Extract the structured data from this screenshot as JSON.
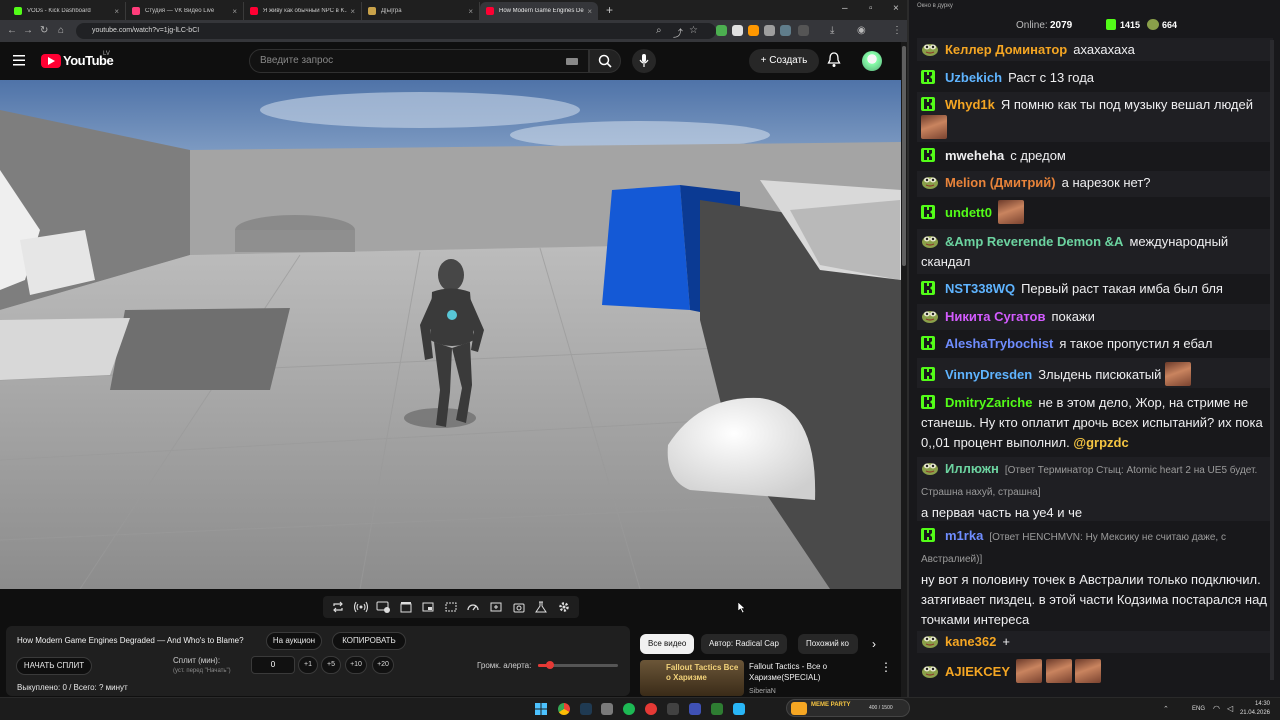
{
  "browser": {
    "tabs": [
      {
        "title": "VODs - Kick Dashboard",
        "color": "#53fc18"
      },
      {
        "title": "Студия — VK Видео Live",
        "color": "#ff3c7a"
      },
      {
        "title": "Я живу как обычный NPC в K...",
        "color": "#ff0033"
      },
      {
        "title": "Д[ы]гра",
        "color": "#c9a24a"
      },
      {
        "title": "How Modern Game Engines De...",
        "color": "#ff0033"
      }
    ],
    "url": "youtube.com/watch?v=1jg-lLC-bCI"
  },
  "youtube": {
    "logo_text": "YouTube",
    "country": "LV",
    "search_placeholder": "Введите запрос",
    "create_label": "Создать"
  },
  "panel": {
    "video_title": "How Modern Game Engines Degraded — And Who's to Blame?",
    "auction_label": "На аукцион",
    "copy_label": "КОПИРОВАТЬ",
    "start_split_label": "НАЧАТЬ СПЛИТ",
    "split_label": "Сплит (мин):",
    "split_sublabel": "(уст. перед \"Начать\")",
    "split_value": "0",
    "increments": [
      "+1",
      "+5",
      "+10",
      "+20"
    ],
    "volume_label": "Громк. алерта:",
    "volume_level": 0.15,
    "status_text": "Выкуплено: 0 / Всего: ? минут"
  },
  "recommendations": {
    "chips": [
      "Все видео",
      "Автор: Radical Cap",
      "Похожий ко"
    ],
    "item": {
      "title": "Fallout Tactics - Все о Харизме(SPECIAL)",
      "channel": "SiberiaN",
      "thumb_text": "Fallout Tactics Все о Харизме"
    }
  },
  "chat": {
    "window_title": "Окно в дуркy",
    "online_label": "Online:",
    "online_count": "2079",
    "kick_count": "1415",
    "other_count": "664",
    "messages": [
      {
        "user": "Келлер Доминатор",
        "color": "#f5a623",
        "badge": "pepe",
        "text": "ахахахаха"
      },
      {
        "user": "Uzbekich",
        "color": "#5fb4ff",
        "badge": "kick",
        "text": "Раст с 13 года"
      },
      {
        "user": "Whyd1k",
        "color": "#f5a623",
        "badge": "kick",
        "text": "Я помню как ты под музыку вешал людей"
      },
      {
        "user": "mweheha",
        "color": "#efeff1",
        "badge": "kick",
        "text": "с дредом"
      },
      {
        "user": "Melion (Дмитрий)",
        "color": "#e8833a",
        "badge": "pepe",
        "text": "а нарезок нет?"
      },
      {
        "user": "undett0",
        "color": "#53fc18",
        "badge": "kick",
        "text": ""
      },
      {
        "user": "&Amp Reverende Demon &A",
        "color": "#6cd3a0",
        "badge": "pepe",
        "text": "международный скандал"
      },
      {
        "user": "NST338WQ",
        "color": "#5fb4ff",
        "badge": "kick",
        "text": "Первый раст такая имба был бля"
      },
      {
        "user": "Никита Сугатов",
        "color": "#d35bff",
        "badge": "pepe",
        "text": "покажи"
      },
      {
        "user": "AleshaTrybochist",
        "color": "#6f8dff",
        "badge": "kick",
        "text": "я такое пропустил я ебал"
      },
      {
        "user": "VinnyDresden",
        "color": "#5fb4ff",
        "badge": "kick",
        "text": "Злыдень писюкатый"
      },
      {
        "user": "DmitryZariche",
        "color": "#53fc18",
        "badge": "kick",
        "text": "не в этом дело, Жор, на стриме не станешь. Ну кто оплатит дрочь всех испытаний? их пока 0,,01 процент выполнил.",
        "mention": "@grpzdc"
      },
      {
        "user": "Иллюжн",
        "color": "#6cd3a0",
        "badge": "pepe",
        "reply": "[Ответ Терминатор Стыц: Atomic heart 2 на UE5 будет. Страшна нахуй, страшна]",
        "text": "а первая часть на уе4 и че"
      },
      {
        "user": "m1rka",
        "color": "#6f8dff",
        "badge": "kick",
        "reply": "[Ответ HENCHMVN: Ну Мексику не считаю даже, с Австралией)]",
        "text": "ну вот я половину точек в Австралии только подключил. затягивает пиздец. в этой части Кодзима постарался над точками интереса"
      },
      {
        "user": "kane362",
        "color": "#f5a623",
        "badge": "pepe",
        "text": "+"
      },
      {
        "user": "AJIEKCEY",
        "color": "#f5a623",
        "badge": "pepe",
        "text": ""
      }
    ]
  },
  "taskbar": {
    "lang": "ENG",
    "time": "14:30",
    "date": "21.04.2026",
    "stream_widget": "MEME PARTY",
    "stream_counter": "400 / 1500"
  }
}
